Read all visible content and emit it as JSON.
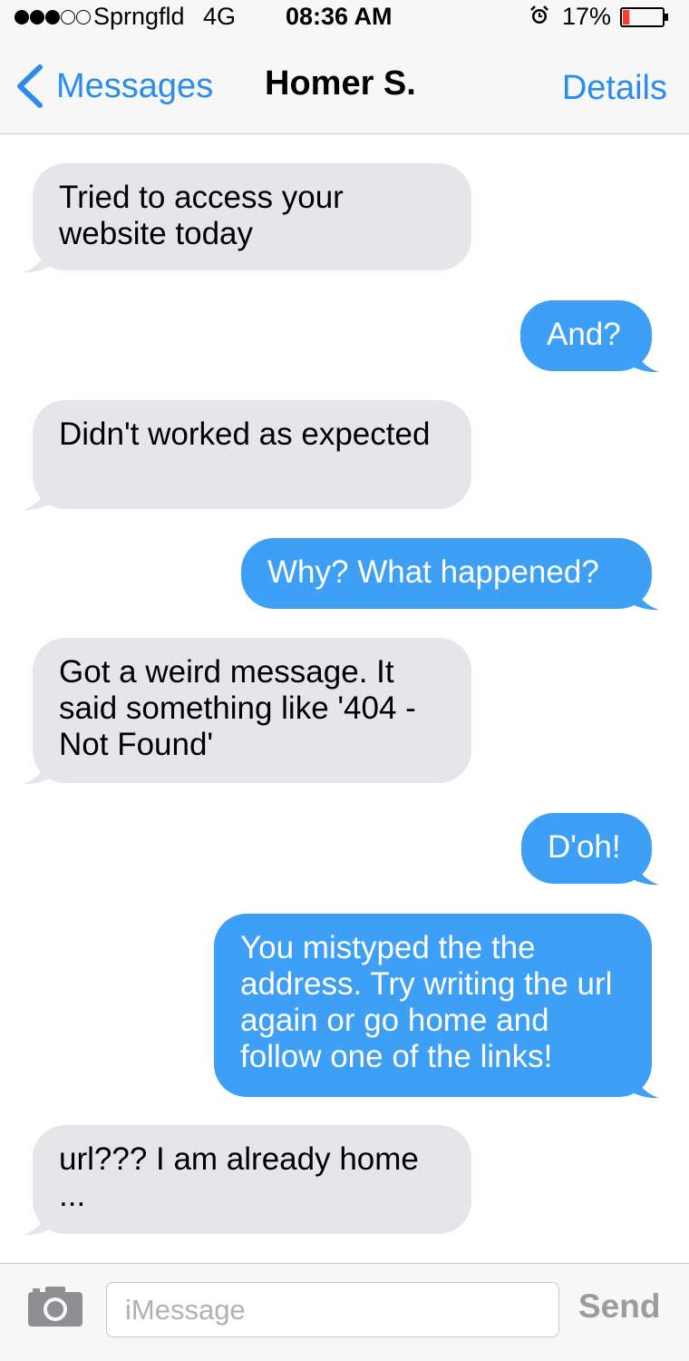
{
  "status_bar": {
    "signal_dots": [
      true,
      true,
      true,
      false,
      false
    ],
    "carrier": "Sprngfld",
    "network": "4G",
    "time": "08:36 AM",
    "alarm_icon": "alarm-clock-icon",
    "battery_percent": "17%",
    "battery_level": 0.17,
    "battery_color": "#ff3b30"
  },
  "nav": {
    "back_label": "Messages",
    "title": "Homer S.",
    "details_label": "Details",
    "accent_color": "#2b8cf0"
  },
  "messages": [
    {
      "direction": "incoming",
      "text": "Tried to access your website today"
    },
    {
      "direction": "outgoing",
      "text": "And?"
    },
    {
      "direction": "incoming",
      "text": "Didn't worked as expected"
    },
    {
      "direction": "outgoing",
      "text": "Why? What happened?"
    },
    {
      "direction": "incoming",
      "text": "Got a weird message. It said something like '404 - Not Found'"
    },
    {
      "direction": "outgoing",
      "text": "D'oh!"
    },
    {
      "direction": "outgoing",
      "text": "You mistyped the the address. Try writing the url again or go home and follow one of the links!"
    },
    {
      "direction": "incoming",
      "text": "url??? I am already home ..."
    }
  ],
  "colors": {
    "incoming_bubble": "#e5e5ea",
    "outgoing_bubble": "#3e9ff7"
  },
  "composer": {
    "camera_icon": "camera-icon",
    "placeholder": "iMessage",
    "value": "",
    "send_label": "Send"
  }
}
